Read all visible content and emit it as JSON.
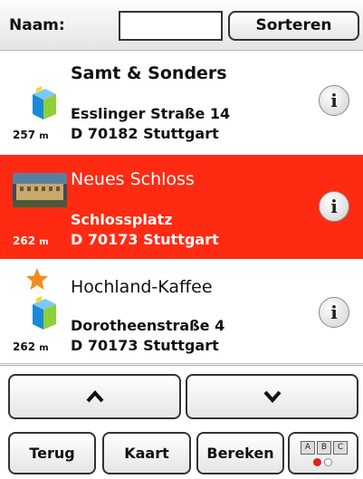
{
  "header": {
    "name_label": "Naam:",
    "name_value": "",
    "sort_label": "Sorteren"
  },
  "items": [
    {
      "name": "Samt & Sonders",
      "street": "Esslinger Straße 14",
      "city": "D 70182 Stuttgart",
      "distance": "257",
      "unit": "m",
      "icon": "shop-cube-icon",
      "selected": false
    },
    {
      "name": "Neues Schloss",
      "street": "Schlossplatz",
      "city": "D 70173 Stuttgart",
      "distance": "262",
      "unit": "m",
      "icon": "palace-photo-icon",
      "selected": true
    },
    {
      "name": "Hochland-Kaffee",
      "street": "Dorotheenstraße 4",
      "city": "D 70173 Stuttgart",
      "distance": "262",
      "unit": "m",
      "icon": "shop-cube-icon",
      "badge": "favorite-star-icon",
      "selected": false
    }
  ],
  "info_glyph": "i",
  "footer": {
    "back_label": "Terug",
    "map_label": "Kaart",
    "calc_label": "Bereken",
    "keyboard_keys": [
      "A",
      "B",
      "C"
    ]
  },
  "colors": {
    "selected_bg": "#ff2a12"
  }
}
